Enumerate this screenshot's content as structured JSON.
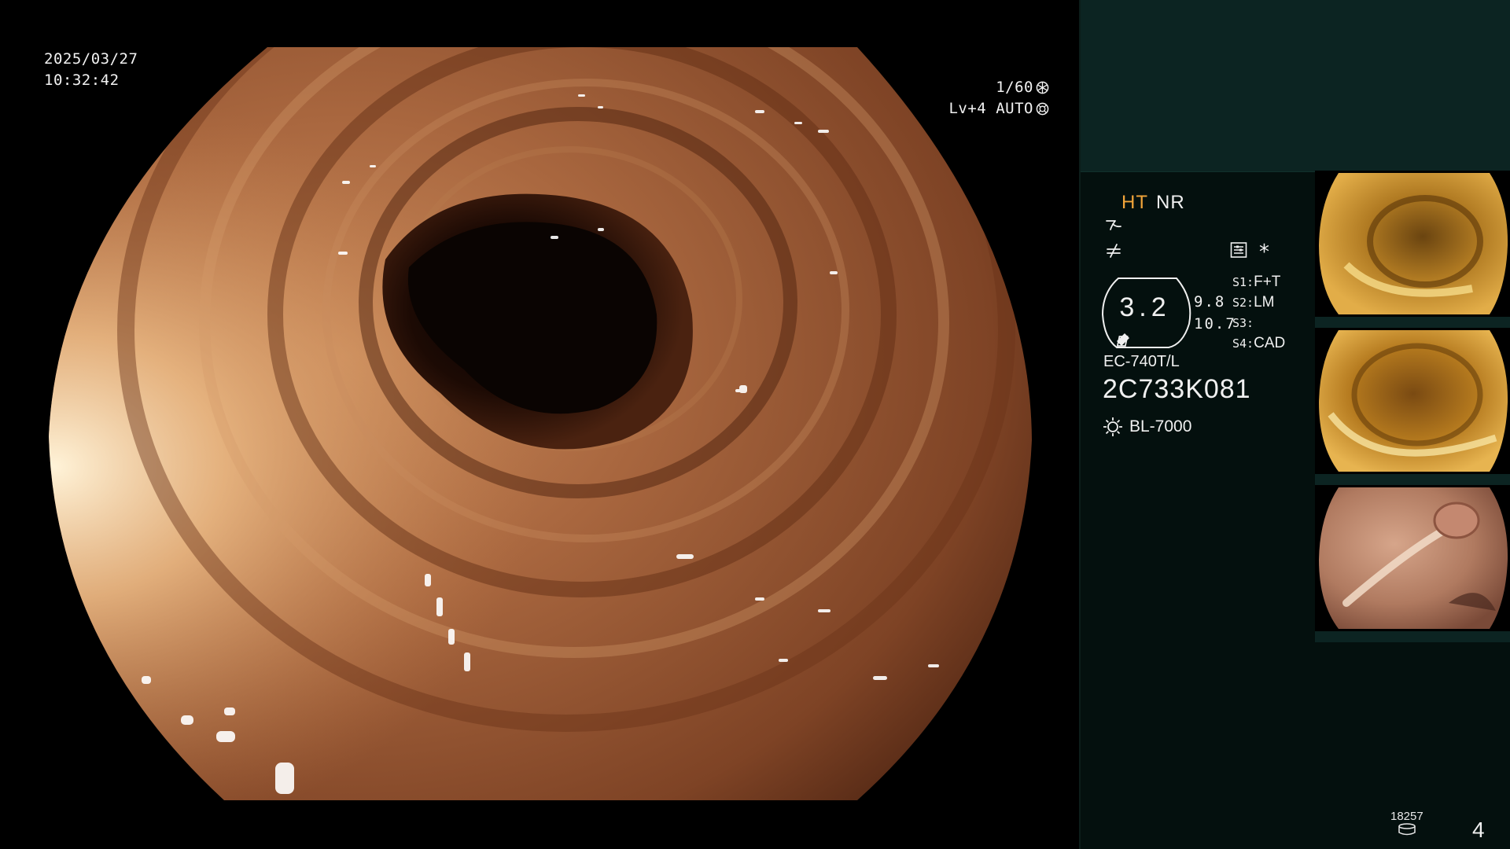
{
  "overlay": {
    "date": "2025/03/27",
    "time": "10:32:42",
    "shutter": "1/60",
    "level": "Lv+4",
    "iris_mode": "AUTO"
  },
  "panel": {
    "ht_label": "HT",
    "nr_label": "NR",
    "zoom_value": "3.2",
    "zoom_side_top": "9.8",
    "zoom_side_bottom": "10.7",
    "asterisk": "*",
    "switches": [
      {
        "key": "S1:",
        "value": "F+T"
      },
      {
        "key": "S2:",
        "value": "LM"
      },
      {
        "key": "S3:",
        "value": ""
      },
      {
        "key": "S4:",
        "value": "CAD"
      }
    ],
    "scope_model": "EC-740T/L",
    "scope_serial": "2C733K081",
    "light_source": "BL-7000",
    "record_count": "18257",
    "page_number": "4"
  },
  "colors": {
    "panel_bg": "#04100e",
    "panel_top_bg": "#0c2422",
    "ht_accent": "#f2a53a",
    "text": "#f0f0f0"
  },
  "icons": [
    "shutter-icon",
    "iris-icon",
    "enhancement-icon",
    "structure-icon",
    "menu-icon",
    "zoom-scope-icon",
    "light-source-icon",
    "storage-icon"
  ]
}
